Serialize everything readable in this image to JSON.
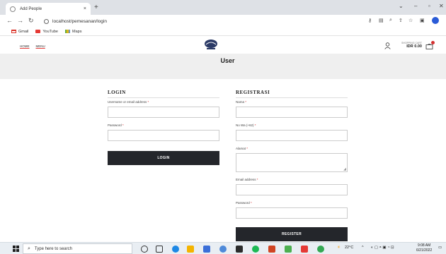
{
  "browser": {
    "tab_title": "Add People",
    "tab_close": "×",
    "new_tab": "+",
    "url": "localhost/pemesanan/login",
    "bookmarks": [
      {
        "label": "Gmail",
        "icon": "gmail-icon"
      },
      {
        "label": "YouTube",
        "icon": "youtube-icon"
      },
      {
        "label": "Maps",
        "icon": "maps-icon"
      }
    ]
  },
  "site": {
    "nav": [
      "HOME",
      "MENU"
    ],
    "cart_label": "SHOPPING CART",
    "cart_amount": "IDR 0.00",
    "page_title": "User"
  },
  "login": {
    "heading": "LOGIN",
    "username_label": "Username or email address",
    "password_label": "Password",
    "button": "LOGIN"
  },
  "register": {
    "heading": "REGISTRASI",
    "name_label": "Nama",
    "phone_label": "No Wa (+62)",
    "address_label": "Alamat",
    "email_label": "Email address",
    "password_label": "Password",
    "button": "REGISTER"
  },
  "required_mark": "*",
  "taskbar": {
    "search_placeholder": "Type here to search",
    "weather": "22°C",
    "time": "9:08 AM",
    "date": "6/21/2022"
  },
  "colors": {
    "button_bg": "#24262b",
    "accent": "#d32f2f",
    "band": "#efefef"
  }
}
